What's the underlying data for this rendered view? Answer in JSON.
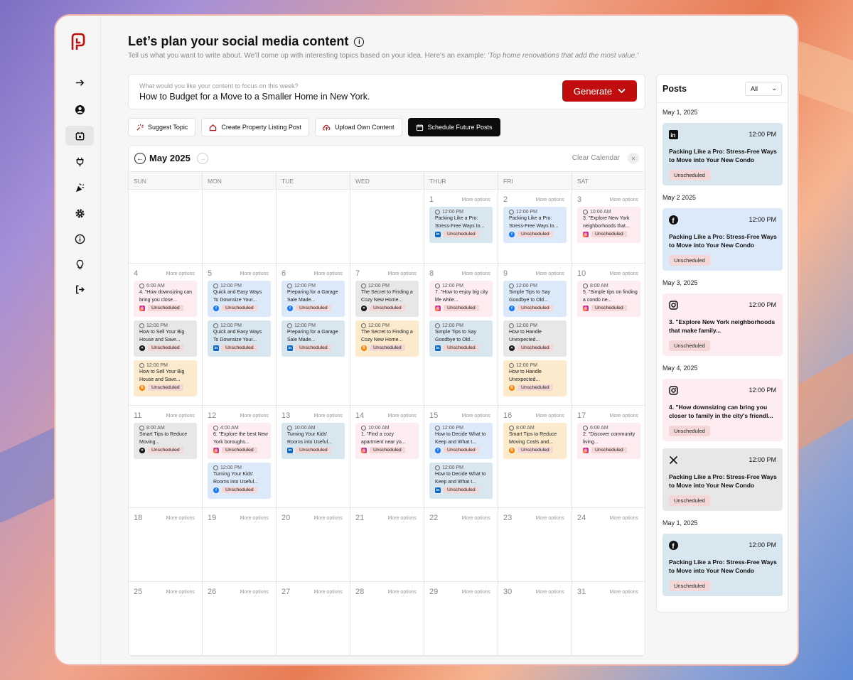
{
  "header": {
    "title": "Let’s plan your social media content",
    "subtitle": "Tell us what you want to write about. We'll come up with interesting topics based on your idea. Here's an example: ",
    "subtitle_example": "'Top home renovations that add the most value.'"
  },
  "prompt": {
    "placeholder": "What would you like your content to focus on this week?",
    "value": "How to Budget for a Move to a Smaller Home in New York.",
    "generate_label": "Generate"
  },
  "actions": {
    "suggest_topic": "Suggest Topic",
    "create_listing": "Create Property Listing Post",
    "upload_content": "Upload Own Content",
    "schedule_future": "Schedule Future Posts"
  },
  "calendar": {
    "month_label": "May 2025",
    "clear_label": "Clear Calendar",
    "more_options": "More options",
    "days_of_week": [
      "SUN",
      "MON",
      "TUE",
      "WED",
      "THUR",
      "FRI",
      "SAT"
    ],
    "status_label": "Unscheduled",
    "weeks": [
      [
        null,
        null,
        null,
        null,
        1,
        2,
        3
      ],
      [
        4,
        5,
        6,
        7,
        8,
        9,
        10
      ],
      [
        11,
        12,
        13,
        14,
        15,
        16,
        17
      ],
      [
        18,
        19,
        20,
        21,
        22,
        23,
        24
      ],
      [
        25,
        26,
        27,
        28,
        29,
        30,
        31
      ]
    ],
    "posts": {
      "1": [
        {
          "time": "12:00 PM",
          "title": "Packing Like a Pro: Stress-Free Ways to...",
          "platform": "linkedin",
          "color": "steel"
        }
      ],
      "2": [
        {
          "time": "12:00 PM",
          "title": "Packing Like a Pro: Stress-Free Ways to...",
          "platform": "facebook",
          "color": "blue"
        }
      ],
      "3": [
        {
          "time": "10:00 AM",
          "title": "3. \"Explore New York neighborhoods that...",
          "platform": "instagram",
          "color": "pink"
        }
      ],
      "4": [
        {
          "time": "6:00 AM",
          "title": "4. \"How downsizing can bring you close...",
          "platform": "instagram",
          "color": "pink"
        },
        {
          "time": "12:00 PM",
          "title": "How to Sell Your Big House and Save...",
          "platform": "x",
          "color": "gray"
        },
        {
          "time": "12:00 PM",
          "title": "How to Sell Your Big House and Save...",
          "platform": "blogger",
          "color": "orange"
        }
      ],
      "5": [
        {
          "time": "12:00 PM",
          "title": "Quick and Easy Ways To Downsize Your...",
          "platform": "facebook",
          "color": "blue"
        },
        {
          "time": "12:00 PM",
          "title": "Quick and Easy Ways To Downsize Your...",
          "platform": "linkedin",
          "color": "steel"
        }
      ],
      "6": [
        {
          "time": "12:00 PM",
          "title": "Preparing for a Garage Sale Made...",
          "platform": "facebook",
          "color": "blue"
        },
        {
          "time": "12:00 PM",
          "title": "Preparing for a Garage Sale Made...",
          "platform": "linkedin",
          "color": "steel"
        }
      ],
      "7": [
        {
          "time": "12:00 PM",
          "title": "The Secret to Finding a Cozy New Home...",
          "platform": "x",
          "color": "gray"
        },
        {
          "time": "12:00 PM",
          "title": "The Secret to Finding a Cozy New Home...",
          "platform": "blogger",
          "color": "orange"
        }
      ],
      "8": [
        {
          "time": "12:00 PM",
          "title": "7. \"How to enjoy big city life while...",
          "platform": "instagram",
          "color": "pink"
        },
        {
          "time": "12:00 PM",
          "title": "Simple Tips to Say Goodbye to Old...",
          "platform": "linkedin",
          "color": "steel"
        }
      ],
      "9": [
        {
          "time": "12:00 PM",
          "title": "Simple Tips to Say Goodbye to Old...",
          "platform": "facebook",
          "color": "blue"
        },
        {
          "time": "12:00 PM",
          "title": "How to Handle Unexpected...",
          "platform": "x",
          "color": "gray"
        },
        {
          "time": "12:00 PM",
          "title": "How to Handle Unexpected...",
          "platform": "blogger",
          "color": "orange"
        }
      ],
      "10": [
        {
          "time": "8:00 AM",
          "title": "5. \"Simple tips on finding a condo ne...",
          "platform": "instagram",
          "color": "pink"
        }
      ],
      "11": [
        {
          "time": "8:00 AM",
          "title": "Smart Tips to Reduce Moving...",
          "platform": "x",
          "color": "gray"
        }
      ],
      "12": [
        {
          "time": "4:00 AM",
          "title": "6. \"Explore the best New York boroughs...",
          "platform": "instagram",
          "color": "pink"
        },
        {
          "time": "12:00 PM",
          "title": "Turning Your Kids' Rooms into Useful...",
          "platform": "facebook",
          "color": "blue"
        }
      ],
      "13": [
        {
          "time": "10:00 AM",
          "title": "Turning Your Kids' Rooms into Useful...",
          "platform": "linkedin",
          "color": "steel"
        }
      ],
      "14": [
        {
          "time": "10:00 AM",
          "title": "1. \"Find a cozy apartment near yo...",
          "platform": "instagram",
          "color": "pink"
        }
      ],
      "15": [
        {
          "time": "12:00 PM",
          "title": "How to Decide What to Keep and What t...",
          "platform": "facebook",
          "color": "blue"
        },
        {
          "time": "12:00 PM",
          "title": "How to Decide What to Keep and What t...",
          "platform": "linkedin",
          "color": "steel"
        }
      ],
      "16": [
        {
          "time": "8:00 AM",
          "title": "Smart Tips to Reduce Moving Costs and...",
          "platform": "blogger",
          "color": "orange"
        }
      ],
      "17": [
        {
          "time": "6:00 AM",
          "title": "2. \"Discover community living...",
          "platform": "instagram",
          "color": "pink"
        }
      ]
    }
  },
  "posts_panel": {
    "title": "Posts",
    "filter_value": "All",
    "groups": [
      {
        "date": "May 1, 2025",
        "time": "12:00 PM",
        "title": "Packing Like a Pro: Stress-Free Ways to Move into Your New Condo",
        "platform": "linkedin",
        "color": "steel",
        "status": "Unscheduled"
      },
      {
        "date": "May 2 2025",
        "time": "12:00 PM",
        "title": "Packing Like a Pro: Stress-Free Ways to Move into Your New Condo",
        "platform": "facebook",
        "color": "blue",
        "status": "Unscheduled"
      },
      {
        "date": "May 3, 2025",
        "time": "12:00 PM",
        "title": "3. \"Explore New York neighborhoods that make family...",
        "platform": "instagram",
        "color": "pink",
        "status": "Unscheduled"
      },
      {
        "date": "May 4, 2025",
        "time": "12:00 PM",
        "title": "4. \"How downsizing can bring you closer to family in the city's friendl...",
        "platform": "instagram",
        "color": "pink",
        "status": "Unscheduled"
      },
      {
        "date": "",
        "time": "12:00 PM",
        "title": "Packing Like a Pro: Stress-Free Ways to Move into Your New Condo",
        "platform": "x",
        "color": "gray",
        "status": "Unscheduled"
      },
      {
        "date": "May 1, 2025",
        "time": "12:00 PM",
        "title": "Packing Like a Pro: Stress-Free Ways to Move into Your New Condo",
        "platform": "facebook",
        "color": "steel",
        "status": "Unscheduled"
      }
    ]
  },
  "colors": {
    "accent": "#c00d0d",
    "dark_button": "#0d0d0d",
    "badge": "#f5d6d6"
  }
}
